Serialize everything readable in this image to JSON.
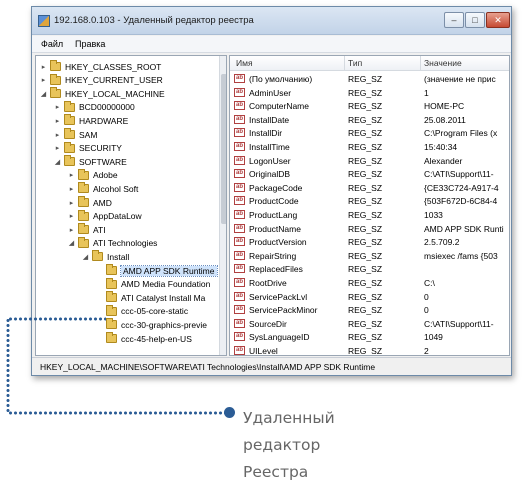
{
  "window": {
    "title": "192.168.0.103 - Удаленный редактор реестра",
    "controls": {
      "minimize": "–",
      "maximize": "□",
      "close": "✕"
    }
  },
  "menu": {
    "file": "Файл",
    "edit": "Правка"
  },
  "tree": {
    "items": [
      {
        "label": "HKEY_CLASSES_ROOT",
        "expander": "▸",
        "level": 0
      },
      {
        "label": "HKEY_CURRENT_USER",
        "expander": "▸",
        "level": 0
      },
      {
        "label": "HKEY_LOCAL_MACHINE",
        "expander": "◢",
        "level": 0
      },
      {
        "label": "BCD00000000",
        "expander": "▸",
        "level": 1
      },
      {
        "label": "HARDWARE",
        "expander": "▸",
        "level": 1
      },
      {
        "label": "SAM",
        "expander": "▸",
        "level": 1
      },
      {
        "label": "SECURITY",
        "expander": "▸",
        "level": 1
      },
      {
        "label": "SOFTWARE",
        "expander": "◢",
        "level": 1
      },
      {
        "label": "Adobe",
        "expander": "▸",
        "level": 2
      },
      {
        "label": "Alcohol Soft",
        "expander": "▸",
        "level": 2
      },
      {
        "label": "AMD",
        "expander": "▸",
        "level": 2
      },
      {
        "label": "AppDataLow",
        "expander": "▸",
        "level": 2
      },
      {
        "label": "ATI",
        "expander": "▸",
        "level": 2
      },
      {
        "label": "ATI Technologies",
        "expander": "◢",
        "level": 2
      },
      {
        "label": "Install",
        "expander": "◢",
        "level": 3
      },
      {
        "label": "AMD APP SDK Runtime",
        "expander": "",
        "level": 4,
        "selected": true
      },
      {
        "label": "AMD Media Foundation",
        "expander": "",
        "level": 4
      },
      {
        "label": "ATI Catalyst Install Ma",
        "expander": "",
        "level": 4
      },
      {
        "label": "ccc-05-core-static",
        "expander": "",
        "level": 4
      },
      {
        "label": "ccc-30-graphics-previe",
        "expander": "",
        "level": 4
      },
      {
        "label": "ccc-45-help-en-US",
        "expander": "",
        "level": 4
      }
    ]
  },
  "list": {
    "headers": {
      "name": "Имя",
      "type": "Тип",
      "data": "Значение"
    },
    "icon_text": "ab",
    "rows": [
      {
        "name": "(По умолчанию)",
        "type": "REG_SZ",
        "data": "(значение не прис"
      },
      {
        "name": "AdminUser",
        "type": "REG_SZ",
        "data": "1"
      },
      {
        "name": "ComputerName",
        "type": "REG_SZ",
        "data": "HOME-PC"
      },
      {
        "name": "InstallDate",
        "type": "REG_SZ",
        "data": "25.08.2011"
      },
      {
        "name": "InstallDir",
        "type": "REG_SZ",
        "data": "C:\\Program Files (x"
      },
      {
        "name": "InstallTime",
        "type": "REG_SZ",
        "data": "15:40:34"
      },
      {
        "name": "LogonUser",
        "type": "REG_SZ",
        "data": "Alexander"
      },
      {
        "name": "OriginalDB",
        "type": "REG_SZ",
        "data": "C:\\ATI\\Support\\11-"
      },
      {
        "name": "PackageCode",
        "type": "REG_SZ",
        "data": "{CE33C724-A917-4"
      },
      {
        "name": "ProductCode",
        "type": "REG_SZ",
        "data": "{503F672D-6C84-4"
      },
      {
        "name": "ProductLang",
        "type": "REG_SZ",
        "data": "1033"
      },
      {
        "name": "ProductName",
        "type": "REG_SZ",
        "data": "AMD APP SDK Runti"
      },
      {
        "name": "ProductVersion",
        "type": "REG_SZ",
        "data": "2.5.709.2"
      },
      {
        "name": "RepairString",
        "type": "REG_SZ",
        "data": "msiexec /fams {503"
      },
      {
        "name": "ReplacedFiles",
        "type": "REG_SZ",
        "data": ""
      },
      {
        "name": "RootDrive",
        "type": "REG_SZ",
        "data": "C:\\"
      },
      {
        "name": "ServicePackLvl",
        "type": "REG_SZ",
        "data": "0"
      },
      {
        "name": "ServicePackMinor",
        "type": "REG_SZ",
        "data": "0"
      },
      {
        "name": "SourceDir",
        "type": "REG_SZ",
        "data": "C:\\ATI\\Support\\11-"
      },
      {
        "name": "SysLanguageID",
        "type": "REG_SZ",
        "data": "1049"
      },
      {
        "name": "UILevel",
        "type": "REG_SZ",
        "data": "2"
      }
    ]
  },
  "status": {
    "path": "HKEY_LOCAL_MACHINE\\SOFTWARE\\ATI Technologies\\Install\\AMD APP SDK Runtime"
  },
  "callout": {
    "lines": [
      "Удаленный",
      "редактор",
      "Реестра"
    ]
  },
  "colors": {
    "accent": "#2b5c95",
    "selection": "#cfe3fb",
    "folder": "#e8c45a",
    "reg_icon": "#b04040"
  }
}
